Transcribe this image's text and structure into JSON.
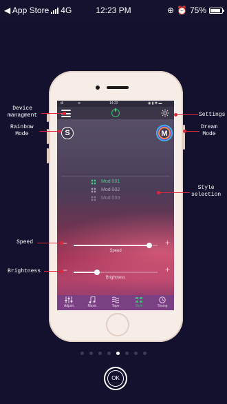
{
  "status_bar": {
    "carrier": "◀ App Store",
    "network": "4G",
    "time": "12:23 PM",
    "battery": "75%"
  },
  "inner_status": {
    "time": "14:22"
  },
  "buttons": {
    "rainbow": "S",
    "dream": "M"
  },
  "modes": [
    {
      "label": "Mod 001"
    },
    {
      "label": "Mod 002"
    },
    {
      "label": "Mod 003"
    }
  ],
  "sliders": {
    "speed": {
      "label": "Speed",
      "value": 0.9
    },
    "brightness": {
      "label": "Brightness",
      "value": 0.28
    }
  },
  "tabs": [
    {
      "label": "Adjust",
      "icon": "sliders-icon"
    },
    {
      "label": "Music",
      "icon": "music-icon"
    },
    {
      "label": "Tape",
      "icon": "tape-icon"
    },
    {
      "label": "Style",
      "icon": "style-icon",
      "active": true
    },
    {
      "label": "Timing",
      "icon": "clock-icon"
    }
  ],
  "callouts": {
    "device": "Device\nmanagment",
    "rainbow": "Rainbow\nMode",
    "settings": "Settings",
    "dream": "Dream\nMode",
    "style": "Style\nselection",
    "speed": "Speed",
    "brightness": "Brightness"
  },
  "pager": {
    "count": 8,
    "current": 5
  },
  "ok_label": "OK",
  "colors": {
    "accent_line": "#e0263b",
    "active_tab": "#49b27a",
    "background": "#13112e"
  }
}
